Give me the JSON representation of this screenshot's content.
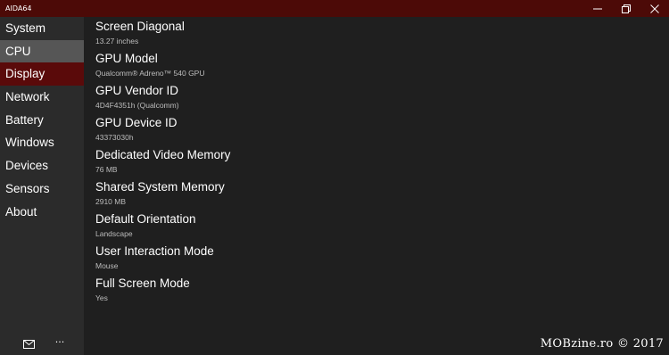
{
  "window": {
    "title": "AIDA64"
  },
  "sidebar": {
    "items": [
      {
        "label": "System"
      },
      {
        "label": "CPU"
      },
      {
        "label": "Display"
      },
      {
        "label": "Network"
      },
      {
        "label": "Battery"
      },
      {
        "label": "Windows"
      },
      {
        "label": "Devices"
      },
      {
        "label": "Sensors"
      },
      {
        "label": "About"
      }
    ],
    "hovered": "CPU",
    "selected": "Display",
    "footer": {
      "mail_icon": "mail-icon",
      "more_label": "..."
    }
  },
  "properties": [
    {
      "label": "Screen Diagonal",
      "value": "13.27 inches"
    },
    {
      "label": "GPU Model",
      "value": "Qualcomm® Adreno™ 540 GPU"
    },
    {
      "label": "GPU Vendor ID",
      "value": "4D4F4351h (Qualcomm)"
    },
    {
      "label": "GPU Device ID",
      "value": "43373030h"
    },
    {
      "label": "Dedicated Video Memory",
      "value": "76 MB"
    },
    {
      "label": "Shared System Memory",
      "value": "2910 MB"
    },
    {
      "label": "Default Orientation",
      "value": "Landscape"
    },
    {
      "label": "User Interaction Mode",
      "value": "Mouse"
    },
    {
      "label": "Full Screen Mode",
      "value": "Yes"
    }
  ],
  "watermark": "MOBzine.ro © 2017",
  "colors": {
    "titlebar": "#4c0a07",
    "selected": "#5a0a0a",
    "hover": "#565656",
    "sidebar": "#2b2b2b",
    "content": "#1f1f1f"
  }
}
